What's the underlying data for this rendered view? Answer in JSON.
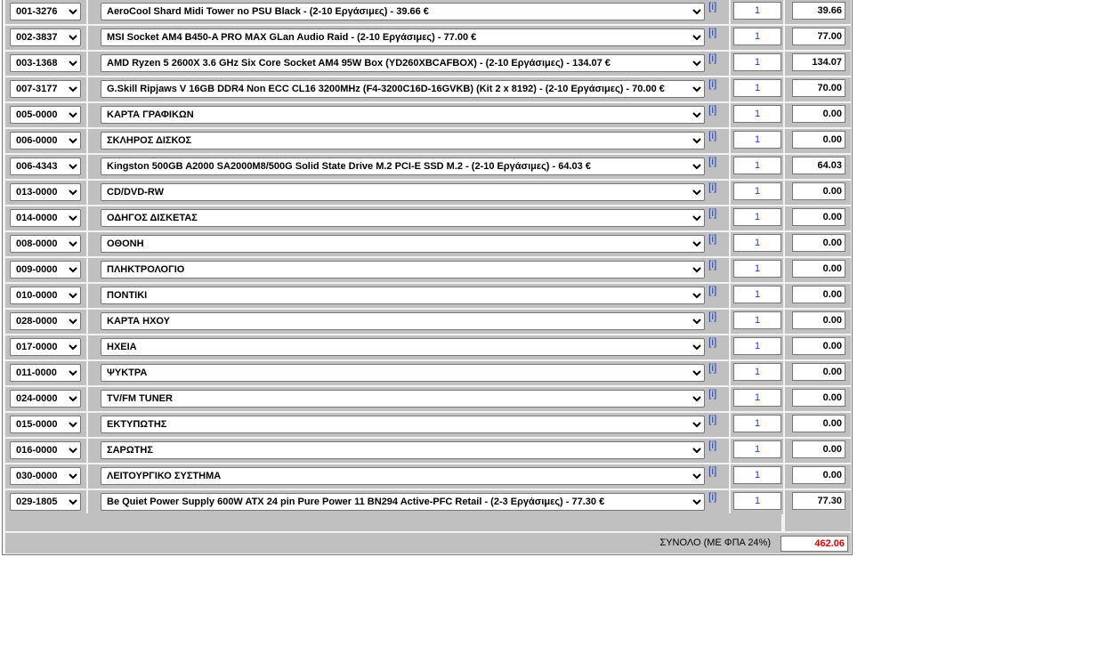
{
  "rows": [
    {
      "code": "001-3276",
      "desc": "AeroCool Shard Midi Tower no PSU Black - (2-10 Εργάσιμες) - 39.66 €",
      "info": "[i]",
      "qty": "1",
      "price": "39.66"
    },
    {
      "code": "002-3837",
      "desc": "MSI Socket AM4 B450-A PRO MAX GLan Audio Raid - (2-10 Εργάσιμες) - 77.00 €",
      "info": "[i]",
      "qty": "1",
      "price": "77.00"
    },
    {
      "code": "003-1368",
      "desc": "AMD Ryzen 5 2600X 3.6 GHz Six Core Socket AM4 95W Box (YD260XBCAFBOX) - (2-10 Εργάσιμες) - 134.07 €",
      "info": "[i]",
      "qty": "1",
      "price": "134.07"
    },
    {
      "code": "007-3177",
      "desc": "G.Skill Ripjaws V 16GB DDR4 Non ECC CL16 3200MHz (F4-3200C16D-16GVKB) (Kit 2 x 8192) - (2-10 Εργάσιμες) - 70.00 €",
      "info": "[i]",
      "qty": "1",
      "price": "70.00"
    },
    {
      "code": "005-0000",
      "desc": "ΚΑΡΤΑ ΓΡΑΦΙΚΩΝ",
      "info": "[i]",
      "qty": "1",
      "price": "0.00"
    },
    {
      "code": "006-0000",
      "desc": "ΣΚΛΗΡΟΣ ΔΙΣΚΟΣ",
      "info": "[i]",
      "qty": "1",
      "price": "0.00"
    },
    {
      "code": "006-4343",
      "desc": "Kingston 500GB A2000 SA2000M8/500G Solid State Drive M.2 PCI-E SSD M.2 - (2-10 Εργάσιμες) - 64.03 €",
      "info": "[i]",
      "qty": "1",
      "price": "64.03"
    },
    {
      "code": "013-0000",
      "desc": "CD/DVD-RW",
      "info": "[i]",
      "qty": "1",
      "price": "0.00"
    },
    {
      "code": "014-0000",
      "desc": "ΟΔΗΓΟΣ ΔΙΣΚΕΤΑΣ",
      "info": "[i]",
      "qty": "1",
      "price": "0.00"
    },
    {
      "code": "008-0000",
      "desc": "ΟΘΟΝΗ",
      "info": "[i]",
      "qty": "1",
      "price": "0.00"
    },
    {
      "code": "009-0000",
      "desc": "ΠΛΗΚΤΡΟΛΟΓΙΟ",
      "info": "[i]",
      "qty": "1",
      "price": "0.00"
    },
    {
      "code": "010-0000",
      "desc": "ΠΟΝΤΙΚΙ",
      "info": "[i]",
      "qty": "1",
      "price": "0.00"
    },
    {
      "code": "028-0000",
      "desc": "ΚΑΡΤΑ ΗΧΟΥ",
      "info": "[i]",
      "qty": "1",
      "price": "0.00"
    },
    {
      "code": "017-0000",
      "desc": "ΗΧΕΙΑ",
      "info": "[i]",
      "qty": "1",
      "price": "0.00"
    },
    {
      "code": "011-0000",
      "desc": "ΨΥΚΤΡΑ",
      "info": "[i]",
      "qty": "1",
      "price": "0.00"
    },
    {
      "code": "024-0000",
      "desc": "TV/FM TUNER",
      "info": "[i]",
      "qty": "1",
      "price": "0.00"
    },
    {
      "code": "015-0000",
      "desc": "ΕΚΤΥΠΩΤΗΣ",
      "info": "[i]",
      "qty": "1",
      "price": "0.00"
    },
    {
      "code": "016-0000",
      "desc": "ΣΑΡΩΤΗΣ",
      "info": "[i]",
      "qty": "1",
      "price": "0.00"
    },
    {
      "code": "030-0000",
      "desc": "ΛΕΙΤΟΥΡΓΙΚΟ ΣΥΣΤΗΜΑ",
      "info": "[i]",
      "qty": "1",
      "price": "0.00"
    },
    {
      "code": "029-1805",
      "desc": "Be Quiet Power Supply 600W ATX 24 pin Pure Power 11 BN294 Active-PFC Retail - (2-3 Εργάσιμες) - 77.30 €",
      "info": "[i]",
      "qty": "1",
      "price": "77.30"
    }
  ],
  "total": {
    "label": "ΣΥΝΟΛΟ (ΜΕ ΦΠΑ 24%)",
    "value": "462.06"
  },
  "colors": {
    "cell_bg": "#c0c0c0",
    "link_blue": "#1a3fcc",
    "total_red": "#e00000"
  }
}
